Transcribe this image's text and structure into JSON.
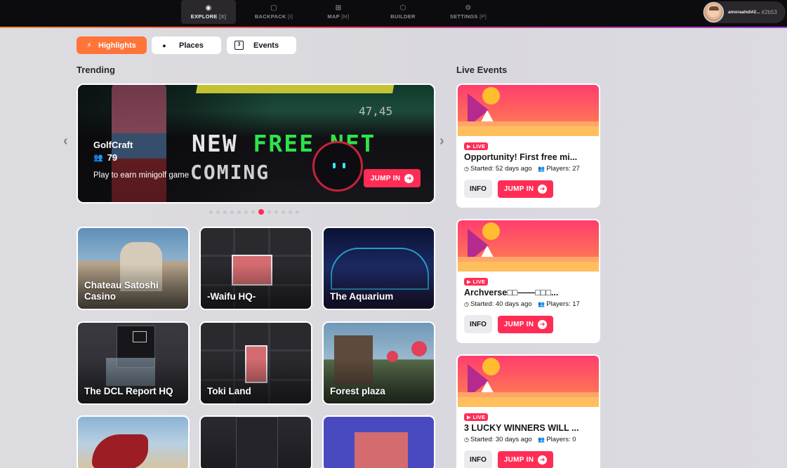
{
  "nav": {
    "tabs": [
      {
        "icon": "compass-icon",
        "glyph": "◉",
        "label": "EXPLORE",
        "key": "[X]"
      },
      {
        "icon": "backpack-icon",
        "glyph": "▢",
        "label": "BACKPACK",
        "key": "[I]"
      },
      {
        "icon": "map-icon",
        "glyph": "⊞",
        "label": "MAP",
        "key": "[M]"
      },
      {
        "icon": "cube-icon",
        "glyph": "⬡",
        "label": "BUILDER",
        "key": ""
      },
      {
        "icon": "gear-icon",
        "glyph": "⚙",
        "label": "SETTINGS",
        "key": "[P]"
      }
    ],
    "user": {
      "name": "amoraahdi#2...",
      "tag": "#2b53"
    }
  },
  "filters": [
    {
      "label": "Highlights",
      "icon": "lightning-icon",
      "glyph": "⚡"
    },
    {
      "label": "Places",
      "icon": "map-pin-icon",
      "glyph": "●"
    },
    {
      "label": "Events",
      "icon": "calendar-icon",
      "glyph": "3"
    }
  ],
  "trending": {
    "title": "Trending",
    "slide": {
      "name": "GolfCraft",
      "players": "79",
      "description": "Play to earn minigolf game",
      "image_text_1a": "NEW ",
      "image_text_1b": "FREE NFT",
      "image_text_2": "COMING",
      "image_numbers": "47,45",
      "jump_label": "JUMP IN"
    },
    "dots_total": 13,
    "dots_active_index": 7
  },
  "scenes": [
    {
      "name": "Chateau Satoshi Casino"
    },
    {
      "name": "-Waifu HQ-"
    },
    {
      "name": "The Aquarium"
    },
    {
      "name": "The DCL Report HQ"
    },
    {
      "name": "Toki Land"
    },
    {
      "name": "Forest plaza"
    },
    {
      "name": ""
    },
    {
      "name": ""
    },
    {
      "name": ""
    }
  ],
  "live_events": {
    "title": "Live Events",
    "badge": "LIVE",
    "info_label": "INFO",
    "jump_label": "JUMP IN",
    "events": [
      {
        "title": "Opportunity! First free mi...",
        "started": "Started: 52 days ago",
        "players": "Players: 27"
      },
      {
        "title": "Archverse□□——□□□...",
        "started": "Started: 40 days ago",
        "players": "Players: 17"
      },
      {
        "title": "3 LUCKY WINNERS WILL ...",
        "started": "Started: 30 days ago",
        "players": "Players: 0"
      }
    ]
  }
}
